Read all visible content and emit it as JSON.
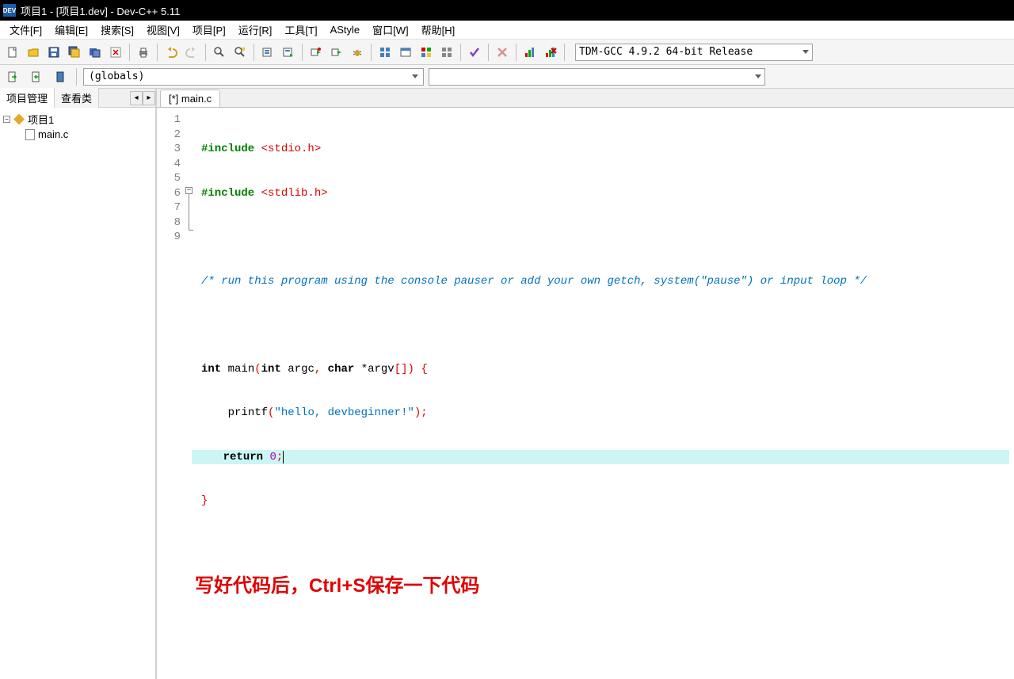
{
  "title": "项目1 - [项目1.dev] - Dev-C++ 5.11",
  "app_icon_text": "DEV",
  "menu": [
    "文件[F]",
    "编辑[E]",
    "搜索[S]",
    "视图[V]",
    "项目[P]",
    "运行[R]",
    "工具[T]",
    "AStyle",
    "窗口[W]",
    "帮助[H]"
  ],
  "compiler": "TDM-GCC 4.9.2 64-bit Release",
  "scope": "(globals)",
  "sidebar_tabs": {
    "project": "项目管理",
    "classes": "查看类"
  },
  "tree": {
    "project": "项目1",
    "file": "main.c"
  },
  "file_tab": "[*] main.c",
  "line_numbers": [
    "1",
    "2",
    "3",
    "4",
    "5",
    "6",
    "7",
    "8",
    "9"
  ],
  "code": {
    "l1_pp": "#include",
    "l1_inc": "<stdio.h>",
    "l2_pp": "#include",
    "l2_inc": "<stdlib.h>",
    "l4": "/* run this program using the console pauser or add your own getch, system(\"pause\") or input loop */",
    "l6_kw1": "int",
    "l6_fn": "main",
    "l6_paren_open": "(",
    "l6_kw2": "int",
    "l6_arg1": " argc",
    "l6_comma": ",",
    "l6_kw3": " char",
    "l6_arg2": " *argv",
    "l6_brk": "[]",
    "l6_paren_close": ")",
    "l6_brace": " {",
    "l7_indent": "    ",
    "l7_fn": "printf",
    "l7_open": "(",
    "l7_str": "\"hello, devbeginner!\"",
    "l7_close": ");",
    "l8_indent": "    ",
    "l8_kw": "return",
    "l8_sp": " ",
    "l8_num": "0",
    "l8_semi": ";",
    "l9": "}"
  },
  "annotation": "写好代码后，Ctrl+S保存一下代码"
}
